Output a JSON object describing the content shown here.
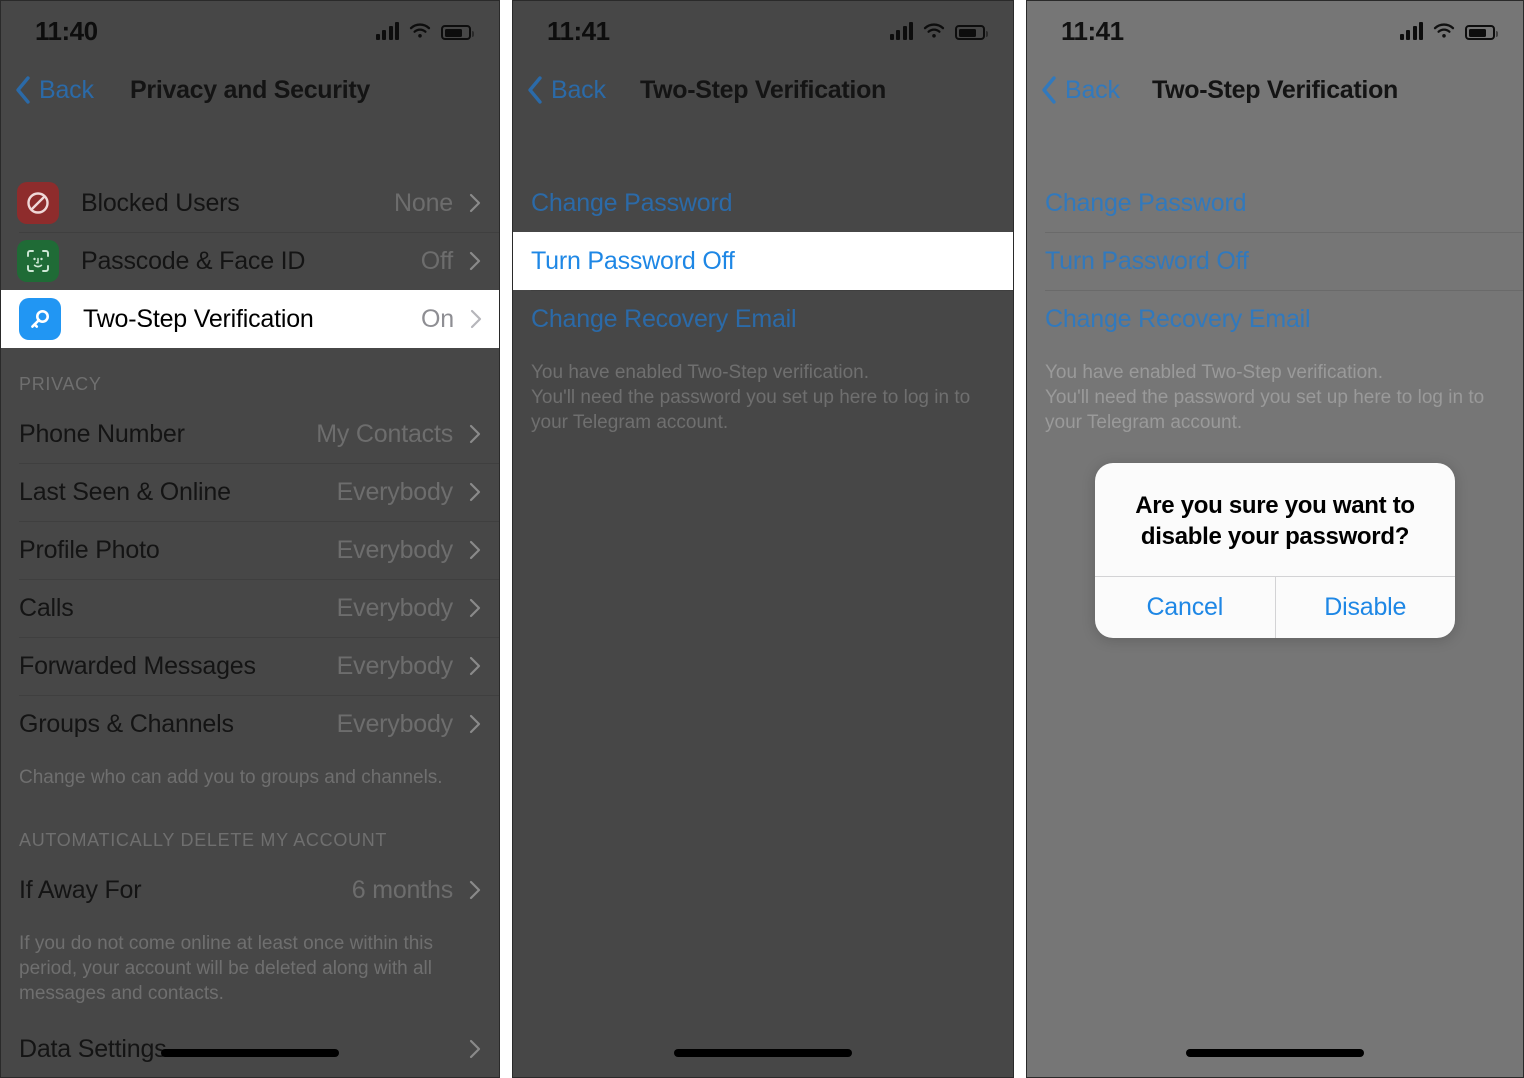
{
  "panels": [
    {
      "id": "privacy-and-security",
      "status": {
        "time": "11:40",
        "signal_icon": "cellular-signal-icon",
        "wifi_icon": "wifi-icon",
        "battery_icon": "battery-icon"
      },
      "nav": {
        "back_label": "Back",
        "back_icon": "chevron-left-icon",
        "title": "Privacy and Security"
      },
      "rows": [
        {
          "icon": "blocked-users-icon",
          "label": "Blocked Users",
          "value": "None",
          "chevron": "chevron-right-icon"
        },
        {
          "icon": "face-id-icon",
          "label": "Passcode & Face ID",
          "value": "Off",
          "chevron": "chevron-right-icon"
        },
        {
          "icon": "key-icon",
          "label": "Two-Step Verification",
          "value": "On",
          "chevron": "chevron-right-icon"
        }
      ],
      "privacy_section": {
        "header": "PRIVACY",
        "rows": [
          {
            "label": "Phone Number",
            "value": "My Contacts",
            "chevron": "chevron-right-icon"
          },
          {
            "label": "Last Seen & Online",
            "value": "Everybody",
            "chevron": "chevron-right-icon"
          },
          {
            "label": "Profile Photo",
            "value": "Everybody",
            "chevron": "chevron-right-icon"
          },
          {
            "label": "Calls",
            "value": "Everybody",
            "chevron": "chevron-right-icon"
          },
          {
            "label": "Forwarded Messages",
            "value": "Everybody",
            "chevron": "chevron-right-icon"
          },
          {
            "label": "Groups & Channels",
            "value": "Everybody",
            "chevron": "chevron-right-icon"
          }
        ],
        "footnote": "Change who can add you to groups and channels."
      },
      "delete_section": {
        "header": "AUTOMATICALLY DELETE MY ACCOUNT",
        "rows": [
          {
            "label": "If Away For",
            "value": "6 months",
            "chevron": "chevron-right-icon"
          }
        ],
        "footnote": "If you do not come online at least once within this period, your account will be deleted along with all messages and contacts."
      },
      "data_section": {
        "rows": [
          {
            "label": "Data Settings",
            "value": "",
            "chevron": "chevron-right-icon"
          }
        ]
      }
    },
    {
      "id": "two-step-verification-highlight",
      "status": {
        "time": "11:41",
        "signal_icon": "cellular-signal-icon",
        "wifi_icon": "wifi-icon",
        "battery_icon": "battery-icon"
      },
      "nav": {
        "back_label": "Back",
        "back_icon": "chevron-left-icon",
        "title": "Two-Step Verification"
      },
      "links": [
        {
          "label": "Change Password",
          "highlighted": false
        },
        {
          "label": "Turn Password Off",
          "highlighted": true
        },
        {
          "label": "Change Recovery Email",
          "highlighted": false
        }
      ],
      "footnote": "You have enabled Two-Step verification.\nYou'll need the password you set up here to log in to your Telegram account."
    },
    {
      "id": "two-step-verification-alert",
      "status": {
        "time": "11:41",
        "signal_icon": "cellular-signal-icon",
        "wifi_icon": "wifi-icon",
        "battery_icon": "battery-icon"
      },
      "nav": {
        "back_label": "Back",
        "back_icon": "chevron-left-icon",
        "title": "Two-Step Verification"
      },
      "links": [
        {
          "label": "Change Password",
          "highlighted": false
        },
        {
          "label": "Turn Password Off",
          "highlighted": false
        },
        {
          "label": "Change Recovery Email",
          "highlighted": false
        }
      ],
      "footnote": "You have enabled Two-Step verification.\nYou'll need the password you set up here to log in to your Telegram account.",
      "alert": {
        "title": "Are you sure you want to disable your password?",
        "cancel_label": "Cancel",
        "confirm_label": "Disable"
      }
    }
  ],
  "colors": {
    "link_blue": "#1e87e5",
    "dim_overlay_dark": "#474747",
    "dim_overlay_light": "#767676",
    "icon_blocked_red": "#8e2c2c",
    "icon_faceid_green": "#1f6b36",
    "icon_key_blue": "#2196f3"
  }
}
